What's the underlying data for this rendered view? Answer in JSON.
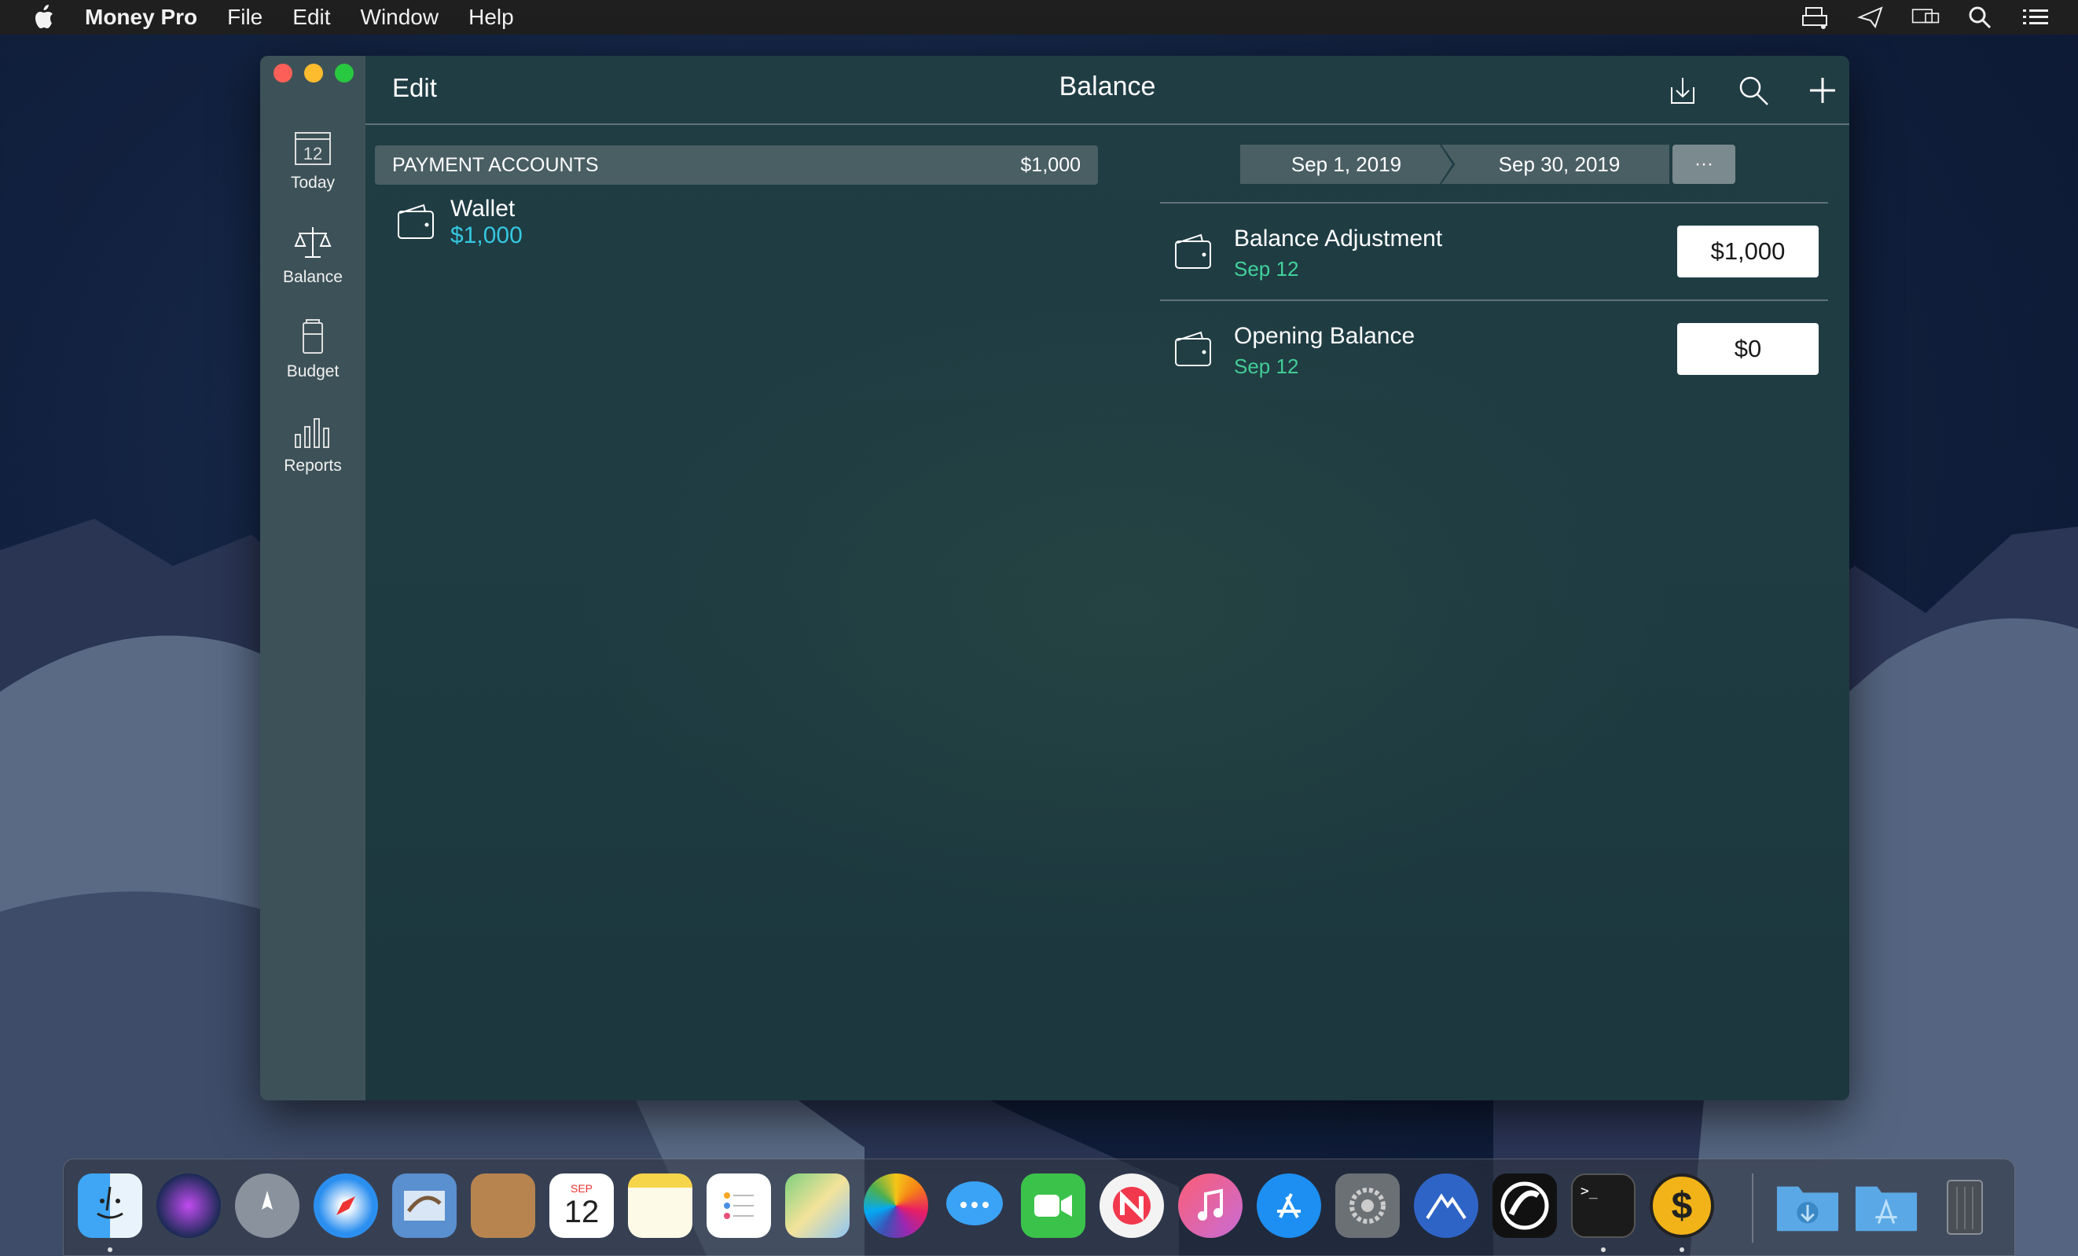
{
  "menubar": {
    "app_name": "Money Pro",
    "items": [
      "File",
      "Edit",
      "Window",
      "Help"
    ],
    "status_icons": [
      "printer-icon",
      "paper-plane-icon",
      "display-icon",
      "spotlight-search-icon",
      "list-icon"
    ]
  },
  "window": {
    "title": "Balance",
    "edit_label": "Edit",
    "header_icons": [
      "download-icon",
      "search-icon",
      "plus-icon"
    ]
  },
  "sidebar": {
    "items": [
      {
        "label": "Today",
        "icon": "calendar-icon",
        "day": "12"
      },
      {
        "label": "Balance",
        "icon": "scales-icon"
      },
      {
        "label": "Budget",
        "icon": "battery-icon"
      },
      {
        "label": "Reports",
        "icon": "bar-chart-icon"
      }
    ]
  },
  "accounts": {
    "section_title": "PAYMENT ACCOUNTS",
    "section_total": "$1,000",
    "items": [
      {
        "name": "Wallet",
        "amount": "$1,000"
      }
    ]
  },
  "date_range": {
    "start": "Sep 1, 2019",
    "end": "Sep 30, 2019",
    "more_label": "···"
  },
  "transactions": [
    {
      "name": "Balance Adjustment",
      "date": "Sep 12",
      "amount": "$1,000"
    },
    {
      "name": "Opening Balance",
      "date": "Sep 12",
      "amount": "$0"
    }
  ],
  "dock": {
    "apps": [
      "Finder",
      "Siri",
      "Launchpad",
      "Safari",
      "Mail",
      "Contacts",
      "Calendar",
      "Notes",
      "Reminders",
      "Maps",
      "Photos",
      "Messages",
      "FaceTime",
      "News",
      "iTunes",
      "App Store",
      "System Preferences",
      "Altitude",
      "Ghostery",
      "Terminal",
      "Money Pro",
      "Downloads",
      "Applications",
      "Trash"
    ],
    "calendar_month": "SEP",
    "calendar_day": "12",
    "terminal_prompt": ">_",
    "money_symbol": "$"
  },
  "colors": {
    "accent_cyan": "#35c8e0",
    "accent_green": "#42d29a",
    "sidebar_bg": "#3d5258"
  }
}
